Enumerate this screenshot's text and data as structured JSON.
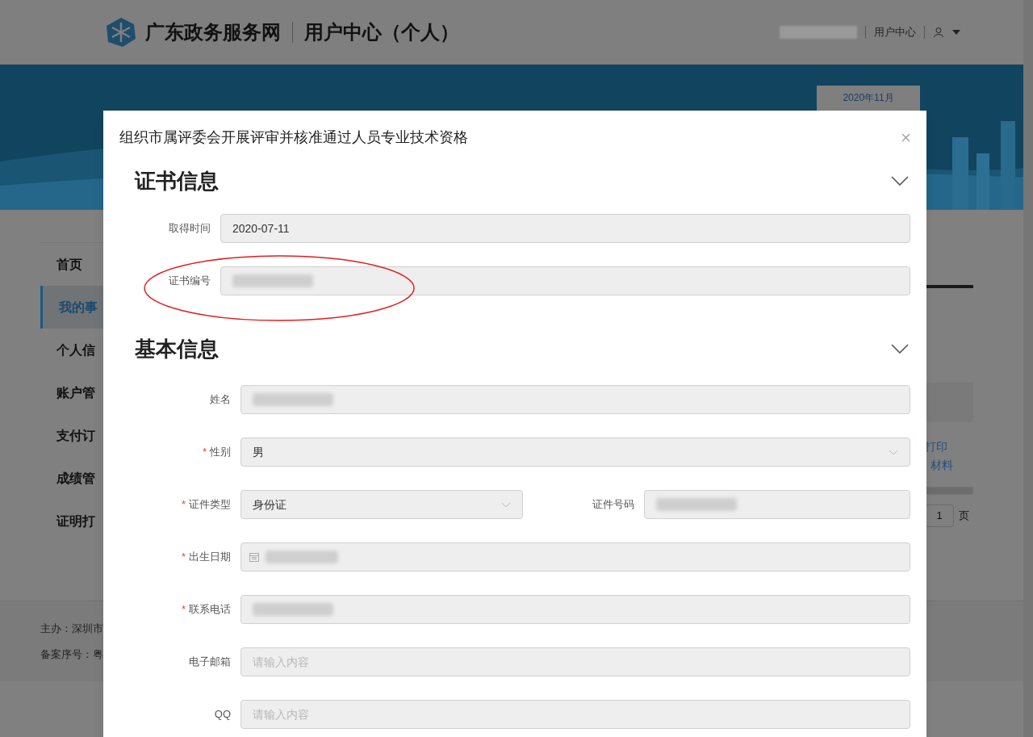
{
  "header": {
    "site_name": "广东政务服务网",
    "section_title": "用户中心（个人）",
    "user_redacted": true,
    "nav_link": "用户中心"
  },
  "banner": {
    "date_tab": "2020年11月"
  },
  "sidebar": {
    "items": [
      {
        "label": "首页",
        "selected": false
      },
      {
        "label": "我的事",
        "selected": true
      },
      {
        "label": "个人信",
        "selected": false
      },
      {
        "label": "账户管",
        "selected": false
      },
      {
        "label": "支付订",
        "selected": false
      },
      {
        "label": "成绩管",
        "selected": false
      },
      {
        "label": "证明打",
        "selected": false
      }
    ]
  },
  "background_right": {
    "links": [
      "打印",
      "材料"
    ],
    "page_input": "1",
    "page_suffix": "页"
  },
  "footer": {
    "lines": [
      "主办：深圳市",
      "备案序号：粤"
    ]
  },
  "dialog": {
    "required_mark": "*",
    "title": "组织市属评委会开展评审并核准通过人员专业技术资格",
    "sections": [
      {
        "title": "证书信息",
        "expanded": true,
        "rows": [
          {
            "fields": [
              {
                "label": "取得时间",
                "required": false,
                "kind": "text",
                "value": "2020-07-11",
                "redacted": false,
                "circled": false
              }
            ]
          },
          {
            "fields": [
              {
                "label": "证书编号",
                "required": false,
                "kind": "text",
                "redacted": true,
                "circled": true
              }
            ]
          }
        ]
      },
      {
        "title": "基本信息",
        "expanded": true,
        "rows": [
          {
            "fields": [
              {
                "label": "姓名",
                "required": false,
                "kind": "text",
                "redacted": true,
                "circled": false
              }
            ]
          },
          {
            "fields": [
              {
                "label": "性别",
                "required": true,
                "kind": "select",
                "value": "男",
                "redacted": false,
                "circled": false
              }
            ]
          },
          {
            "fields": [
              {
                "label": "证件类型",
                "required": true,
                "kind": "select",
                "value": "身份证",
                "redacted": false,
                "circled": false
              },
              {
                "label": "证件号码",
                "required": false,
                "kind": "text",
                "redacted": true,
                "circled": false
              }
            ]
          },
          {
            "fields": [
              {
                "label": "出生日期",
                "required": true,
                "kind": "date",
                "redacted": true,
                "circled": false
              }
            ]
          },
          {
            "fields": [
              {
                "label": "联系电话",
                "required": true,
                "kind": "text",
                "redacted": true,
                "circled": false
              }
            ]
          },
          {
            "fields": [
              {
                "label": "电子邮箱",
                "required": false,
                "kind": "text",
                "placeholder": "请输入内容",
                "redacted": false,
                "circled": false
              }
            ]
          },
          {
            "fields": [
              {
                "label": "QQ",
                "required": false,
                "kind": "text",
                "placeholder": "请输入内容",
                "redacted": false,
                "circled": false
              }
            ]
          }
        ]
      }
    ]
  }
}
